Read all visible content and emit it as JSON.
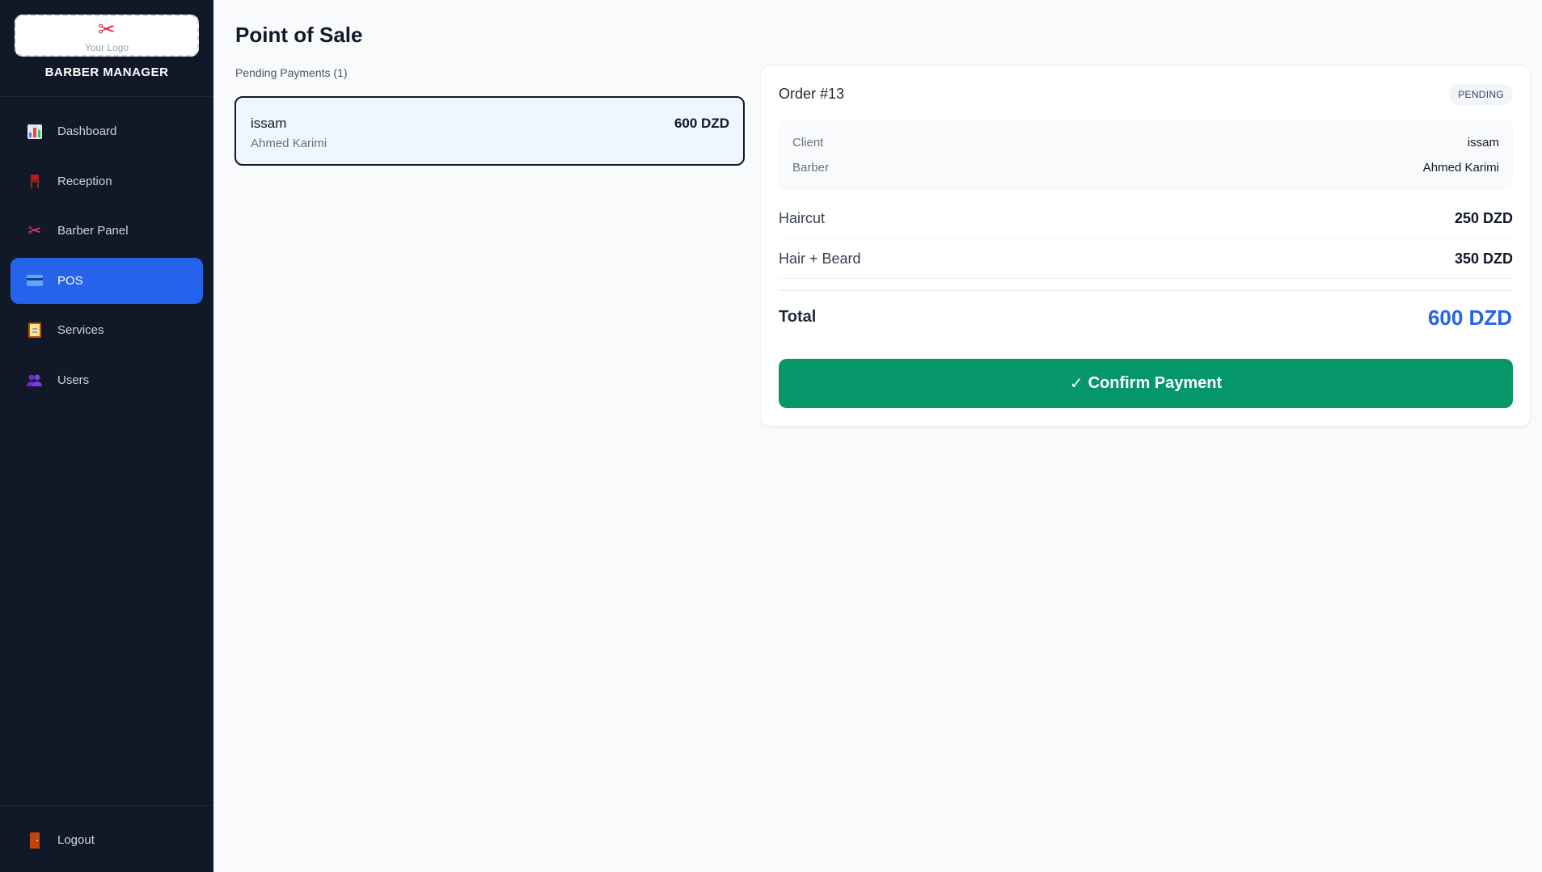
{
  "sidebar": {
    "logo": {
      "icon": "scissors-icon",
      "text": "Your Logo"
    },
    "brand": "BARBER MANAGER",
    "items": [
      {
        "label": "Dashboard",
        "icon": "bar-chart-icon"
      },
      {
        "label": "Reception",
        "icon": "chair-icon"
      },
      {
        "label": "Barber Panel",
        "icon": "scissors-icon"
      },
      {
        "label": "POS",
        "icon": "credit-card-icon",
        "active": true
      },
      {
        "label": "Services",
        "icon": "clipboard-icon"
      },
      {
        "label": "Users",
        "icon": "users-icon"
      }
    ],
    "logout": {
      "label": "Logout",
      "icon": "door-icon"
    }
  },
  "main": {
    "title": "Point of Sale",
    "pending_label": "Pending Payments (1)",
    "pending": [
      {
        "client": "issam",
        "barber": "Ahmed Karimi",
        "amount": "600 DZD"
      }
    ]
  },
  "order": {
    "title": "Order #13",
    "status": "PENDING",
    "client_label": "Client",
    "client": "issam",
    "barber_label": "Barber",
    "barber": "Ahmed Karimi",
    "services": [
      {
        "name": "Haircut",
        "price": "250 DZD"
      },
      {
        "name": "Hair + Beard",
        "price": "350 DZD"
      }
    ],
    "total_label": "Total",
    "total": "600 DZD",
    "confirm_icon": "checkmark-icon",
    "confirm_label": "Confirm Payment"
  },
  "colors": {
    "sidebar_bg": "#111827",
    "accent": "#2563eb",
    "success": "#059669",
    "page_bg": "#f8fafc"
  }
}
